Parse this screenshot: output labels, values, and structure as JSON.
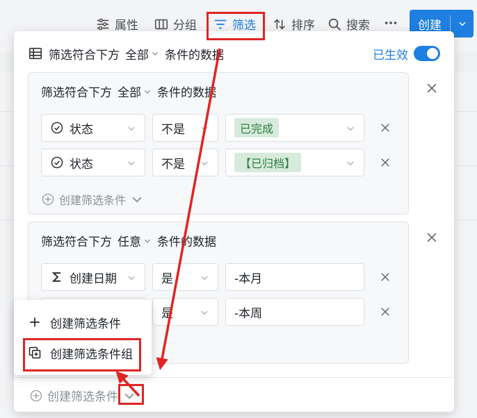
{
  "toolbar": {
    "properties": "属性",
    "group": "分组",
    "filter": "筛选",
    "sort": "排序",
    "search": "搜索",
    "create": "创建"
  },
  "panel": {
    "head": {
      "prefix": "筛选符合下方",
      "mode": "全部",
      "suffix": "条件的数据"
    },
    "active_label": "已生效",
    "groups": [
      {
        "head": {
          "prefix": "筛选符合下方",
          "mode": "全部",
          "suffix": "条件的数据"
        },
        "rows": [
          {
            "field": "状态",
            "op": "不是",
            "value": "已完成"
          },
          {
            "field": "状态",
            "op": "不是",
            "value": "【已归档】"
          }
        ],
        "add_condition": "创建筛选条件"
      },
      {
        "head": {
          "prefix": "筛选符合下方",
          "mode": "任意",
          "suffix": "条件的数据"
        },
        "rows": [
          {
            "field": "创建日期",
            "op": "是",
            "value": "-本月"
          },
          {
            "field": "",
            "op": "是",
            "value": "-本周"
          }
        ]
      }
    ],
    "bottom_add": "创建筛选条件"
  },
  "menu": {
    "items": [
      {
        "label": "创建筛选条件"
      },
      {
        "label": "创建筛选条件组"
      }
    ]
  },
  "colors": {
    "accent": "#1e7fe0",
    "annotation": "#e02424",
    "tag_bg": "#d6ebdb",
    "tag_text": "#2f7d43"
  }
}
